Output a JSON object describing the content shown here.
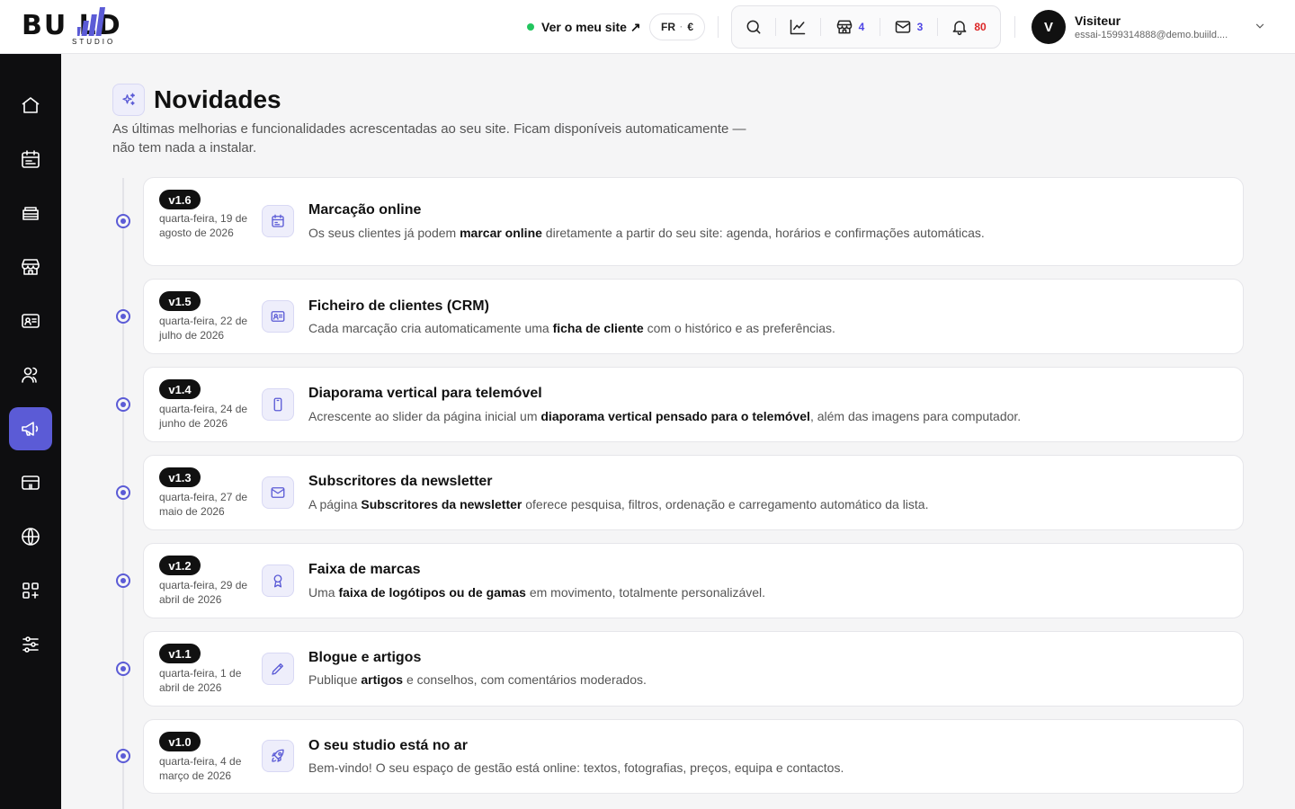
{
  "brand": {
    "logo_main": "BU  LD",
    "logo_sub": "STUDIO"
  },
  "topbar": {
    "site_link": "Ver o meu site ↗",
    "lang": "FR",
    "lang_sep": "·",
    "currency": "€",
    "counts": {
      "stores": "4",
      "messages": "3",
      "notifications": "80"
    },
    "user": {
      "initial": "V",
      "name": "Visiteur",
      "email": "essai-1599314888@demo.buiild...."
    }
  },
  "sidebar": {
    "items": [
      {
        "name": "home",
        "icon": "home-icon",
        "active": false
      },
      {
        "name": "calendar",
        "icon": "calendar-icon",
        "active": false
      },
      {
        "name": "services",
        "icon": "tray-stack-icon",
        "active": false
      },
      {
        "name": "store",
        "icon": "store-icon",
        "active": false
      },
      {
        "name": "contacts",
        "icon": "id-card-icon",
        "active": false
      },
      {
        "name": "team",
        "icon": "users-icon",
        "active": false
      },
      {
        "name": "news",
        "icon": "megaphone-icon",
        "active": true
      },
      {
        "name": "payments",
        "icon": "card-icon",
        "active": false
      },
      {
        "name": "website",
        "icon": "globe-icon",
        "active": false
      },
      {
        "name": "apps",
        "icon": "apps-add-icon",
        "active": false
      },
      {
        "name": "settings",
        "icon": "sliders-icon",
        "active": false
      }
    ]
  },
  "page": {
    "title": "Novidades",
    "subtitle": "As últimas melhorias e funcionalidades acrescentadas ao seu site. Ficam disponíveis automaticamente — não tem nada a instalar."
  },
  "releases": [
    {
      "version": "v1.6",
      "date": "quarta-feira, 19 de agosto de 2026",
      "icon": "calendar-icon",
      "title": "Marcação online",
      "desc_pre": "Os seus clientes já podem ",
      "desc_bold": "marcar online",
      "desc_post": " diretamente a partir do seu site: agenda, horários e confirmações automáticas."
    },
    {
      "version": "v1.5",
      "date": "quarta-feira, 22 de julho de 2026",
      "icon": "id-card-icon",
      "title": "Ficheiro de clientes (CRM)",
      "desc_pre": "Cada marcação cria automaticamente uma ",
      "desc_bold": "ficha de cliente",
      "desc_post": " com o histórico e as preferências."
    },
    {
      "version": "v1.4",
      "date": "quarta-feira, 24 de junho de 2026",
      "icon": "phone-icon",
      "title": "Diaporama vertical para telemóvel",
      "desc_pre": "Acrescente ao slider da página inicial um ",
      "desc_bold": "diaporama vertical pensado para o telemóvel",
      "desc_post": ", além das imagens para computador."
    },
    {
      "version": "v1.3",
      "date": "quarta-feira, 27 de maio de 2026",
      "icon": "mail-icon",
      "title": "Subscritores da newsletter",
      "desc_pre": "A página ",
      "desc_bold": "Subscritores da newsletter",
      "desc_post": " oferece pesquisa, filtros, ordenação e carregamento automático da lista."
    },
    {
      "version": "v1.2",
      "date": "quarta-feira, 29 de abril de 2026",
      "icon": "award-icon",
      "title": "Faixa de marcas",
      "desc_pre": "Uma ",
      "desc_bold": "faixa de logótipos ou de gamas",
      "desc_post": " em movimento, totalmente personalizável."
    },
    {
      "version": "v1.1",
      "date": "quarta-feira, 1 de abril de 2026",
      "icon": "pencil-icon",
      "title": "Blogue e artigos",
      "desc_pre": "Publique ",
      "desc_bold": "artigos",
      "desc_post": " e conselhos, com comentários moderados."
    },
    {
      "version": "v1.0",
      "date": "quarta-feira, 4 de março de 2026",
      "icon": "rocket-icon",
      "title": "O seu studio está no ar",
      "desc_pre": "Bem-vindo! O seu espaço de gestão está online: textos, fotografias, preços, equipa e contactos.",
      "desc_bold": "",
      "desc_post": ""
    }
  ],
  "colors": {
    "accent": "#5b5bd6",
    "sidebar_bg": "#0e0e10",
    "danger": "#dc2626",
    "online": "#22c55e"
  }
}
